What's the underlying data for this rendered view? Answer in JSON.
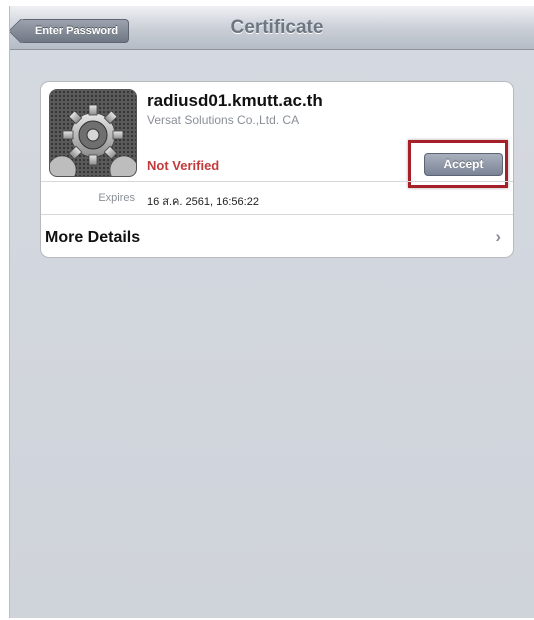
{
  "navbar": {
    "back_label": "Enter Password",
    "title": "Certificate"
  },
  "certificate": {
    "icon": "gear-certificate-icon",
    "name": "radiusd01.kmutt.ac.th",
    "issuer": "Versat Solutions Co.,Ltd. CA",
    "status": "Not Verified",
    "accept_label": "Accept",
    "expires_label": "Expires",
    "expires_value": "16 ส.ค. 2561, 16:56:22"
  },
  "more_details": {
    "label": "More Details",
    "chevron": "›"
  },
  "colors": {
    "status_red": "#c23a3a",
    "highlight_red": "#a6202a",
    "accent_button": "#7b8496"
  }
}
